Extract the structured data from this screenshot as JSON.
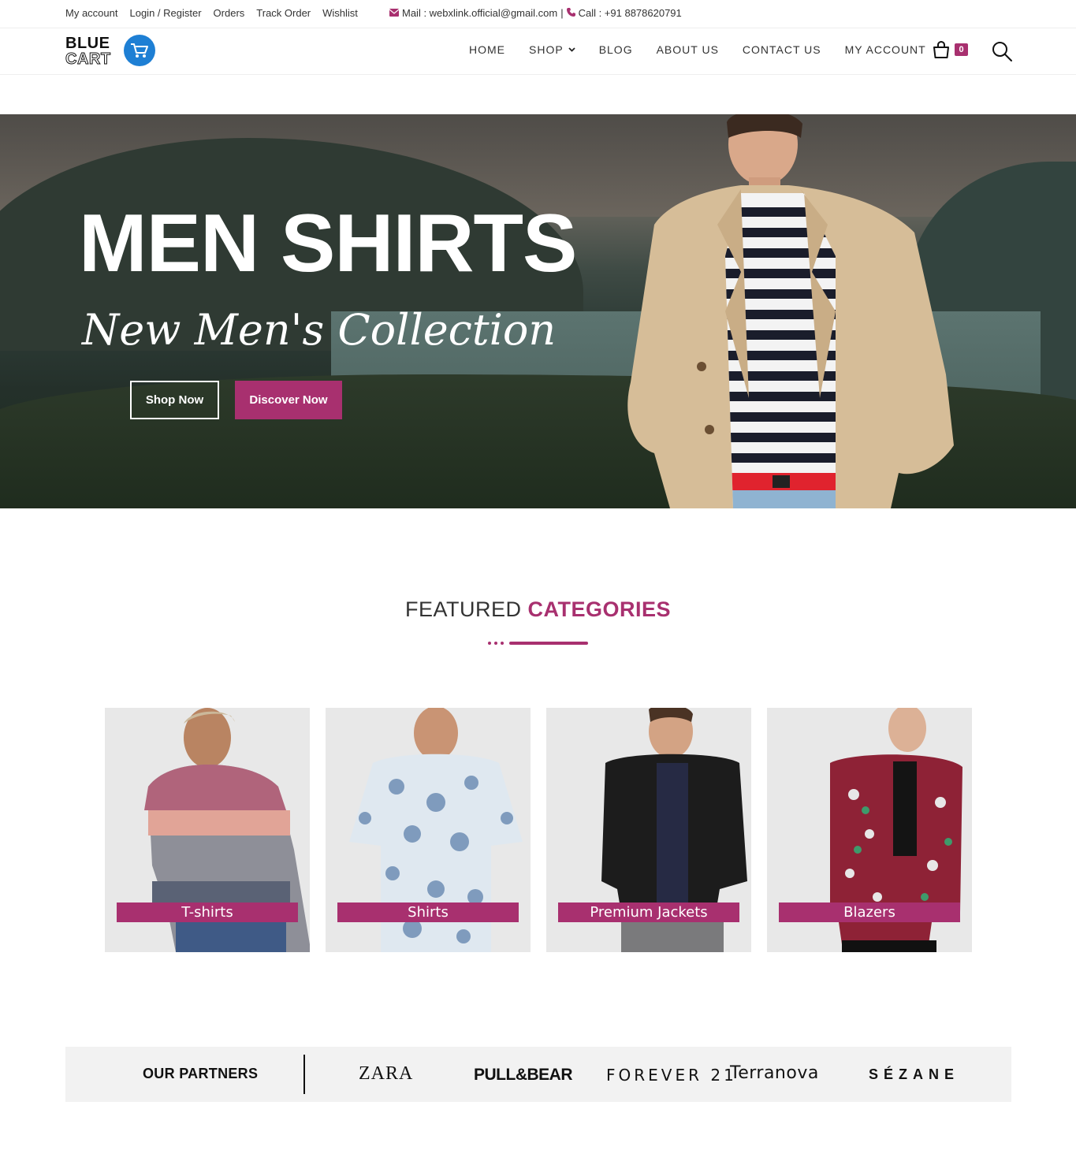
{
  "topbar": {
    "links": [
      "My account",
      "Login / Register",
      "Orders",
      "Track Order",
      "Wishlist"
    ],
    "mail": "Mail : webxlink.official@gmail.com",
    "separator": "|",
    "call": "Call : +91 8878620791"
  },
  "logo": {
    "line1": "BLUE",
    "line2": "CART"
  },
  "nav": {
    "items": [
      "HOME",
      "SHOP",
      "BLOG",
      "ABOUT US",
      "CONTACT US",
      "MY ACCOUNT"
    ],
    "cart_count": "0"
  },
  "hero": {
    "headline": "MEN SHIRTS",
    "subheadline": "New Men's Collection",
    "primary_button": "Shop Now",
    "secondary_button": "Discover Now"
  },
  "featured": {
    "title_part1": "FEATURED",
    "title_part2": "CATEGORIES",
    "categories": [
      "T-shirts",
      "Shirts",
      "Premium Jackets",
      "Blazers"
    ]
  },
  "partners": {
    "title": "OUR PARTNERS",
    "brands": [
      "ZARA",
      "PULL&BEAR",
      "FOREVER 21",
      "Terranova",
      "SÉZANE"
    ]
  },
  "colors": {
    "accent": "#a8306f",
    "logo_blue": "#1e7fd4"
  }
}
